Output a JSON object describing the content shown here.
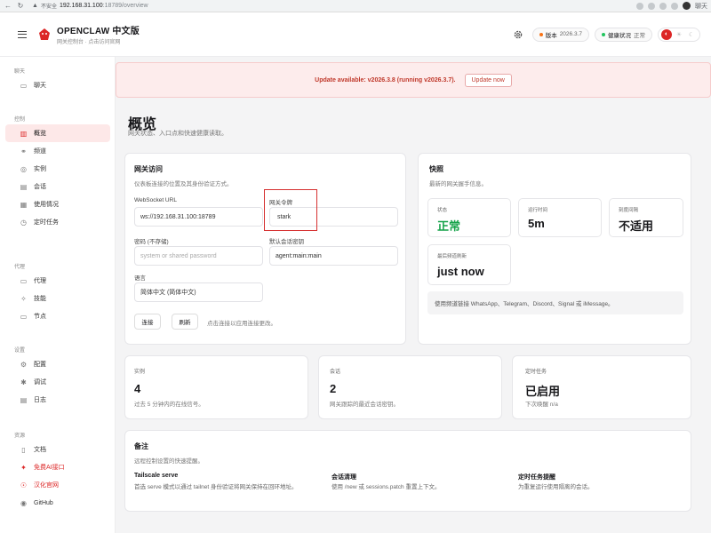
{
  "browser": {
    "insecure": "不安全",
    "url_host": "192.168.31.100",
    "url_path": ":18789/overview",
    "chat_label": "聊天"
  },
  "header": {
    "brand_title": "OPENCLAW 中文版",
    "brand_sub": "网关控制台 · 点击访问官网",
    "version_label": "版本",
    "version_value": "2026.3.7",
    "health_label": "健康状况",
    "health_value": "正常",
    "accent": "#dc2626",
    "version_dot": "#f97316",
    "health_dot": "#22c55e"
  },
  "sidebar": {
    "groups": [
      {
        "label": "聊天",
        "items": [
          {
            "label": "聊天",
            "icon": "chat-icon"
          }
        ]
      },
      {
        "label": "控制",
        "items": [
          {
            "label": "概览",
            "icon": "chart-icon",
            "active": true
          },
          {
            "label": "频道",
            "icon": "link-icon"
          },
          {
            "label": "实例",
            "icon": "radio-icon"
          },
          {
            "label": "会话",
            "icon": "file-icon"
          },
          {
            "label": "使用情况",
            "icon": "bar-chart-icon"
          },
          {
            "label": "定时任务",
            "icon": "clock-icon"
          }
        ]
      },
      {
        "label": "代理",
        "items": [
          {
            "label": "代理",
            "icon": "folder-icon"
          },
          {
            "label": "技能",
            "icon": "sparkle-icon"
          },
          {
            "label": "节点",
            "icon": "monitor-icon"
          }
        ]
      },
      {
        "label": "设置",
        "items": [
          {
            "label": "配置",
            "icon": "gear-icon"
          },
          {
            "label": "调试",
            "icon": "bug-icon"
          },
          {
            "label": "日志",
            "icon": "log-icon"
          }
        ]
      },
      {
        "label": "资源",
        "items": [
          {
            "label": "文档",
            "icon": "book-icon"
          },
          {
            "label": "免费AI接口",
            "icon": "gift-icon",
            "red": true
          },
          {
            "label": "汉化官网",
            "icon": "cn-icon",
            "red": true
          },
          {
            "label": "GitHub",
            "icon": "github-icon"
          }
        ]
      }
    ]
  },
  "banner": {
    "text": "Update available: v2026.3.8 (running v2026.3.7).",
    "button": "Update now"
  },
  "page": {
    "title": "概览",
    "subtitle": "网关状态、入口点和快速健康读取。"
  },
  "gateway": {
    "title": "网关访问",
    "subtitle": "仪表板连接的位置及其身份验证方式。",
    "ws_label": "WebSocket URL",
    "ws_value": "ws://192.168.31.100:18789",
    "token_label": "网关令牌",
    "token_value": "stark",
    "password_label": "密码 (不存储)",
    "password_placeholder": "system or shared password",
    "session_label": "默认会话密钥",
    "session_value": "agent:main:main",
    "lang_label": "语言",
    "lang_value": "简体中文 (简体中文)",
    "connect_btn": "连接",
    "refresh_btn": "刷新",
    "hint": "点击连接以应用连接更改。"
  },
  "snapshot": {
    "title": "快照",
    "subtitle": "最新的网关握手信息。",
    "stats": [
      {
        "label": "状态",
        "value": "正常",
        "color": "#16a34a"
      },
      {
        "label": "运行时间",
        "value": "5m"
      },
      {
        "label": "刻度间隔",
        "value": "不适用"
      },
      {
        "label": "最后频道刷新",
        "value": "just now"
      }
    ],
    "note": "使用频道链接 WhatsApp、Telegram、Discord、Signal 或 iMessage。"
  },
  "metrics": [
    {
      "label": "实例",
      "value": "4",
      "desc": "过去 5 分钟内的在线信号。"
    },
    {
      "label": "会话",
      "value": "2",
      "desc": "网关跟踪的最近会话密钥。"
    },
    {
      "label": "定时任务",
      "value": "已启用",
      "desc": "下次唤醒 n/a"
    }
  ],
  "notes": {
    "title": "备注",
    "subtitle": "远程控制设置的快速提醒。",
    "cols": [
      {
        "title": "Tailscale serve",
        "desc": "首选 serve 模式以通过 tailnet 身份验证将网关保持在回环地址。"
      },
      {
        "title": "会话清理",
        "desc": "使用 /new 或 sessions.patch 重置上下文。"
      },
      {
        "title": "定时任务提醒",
        "desc": "为重复运行使用隔离的会话。"
      }
    ]
  }
}
